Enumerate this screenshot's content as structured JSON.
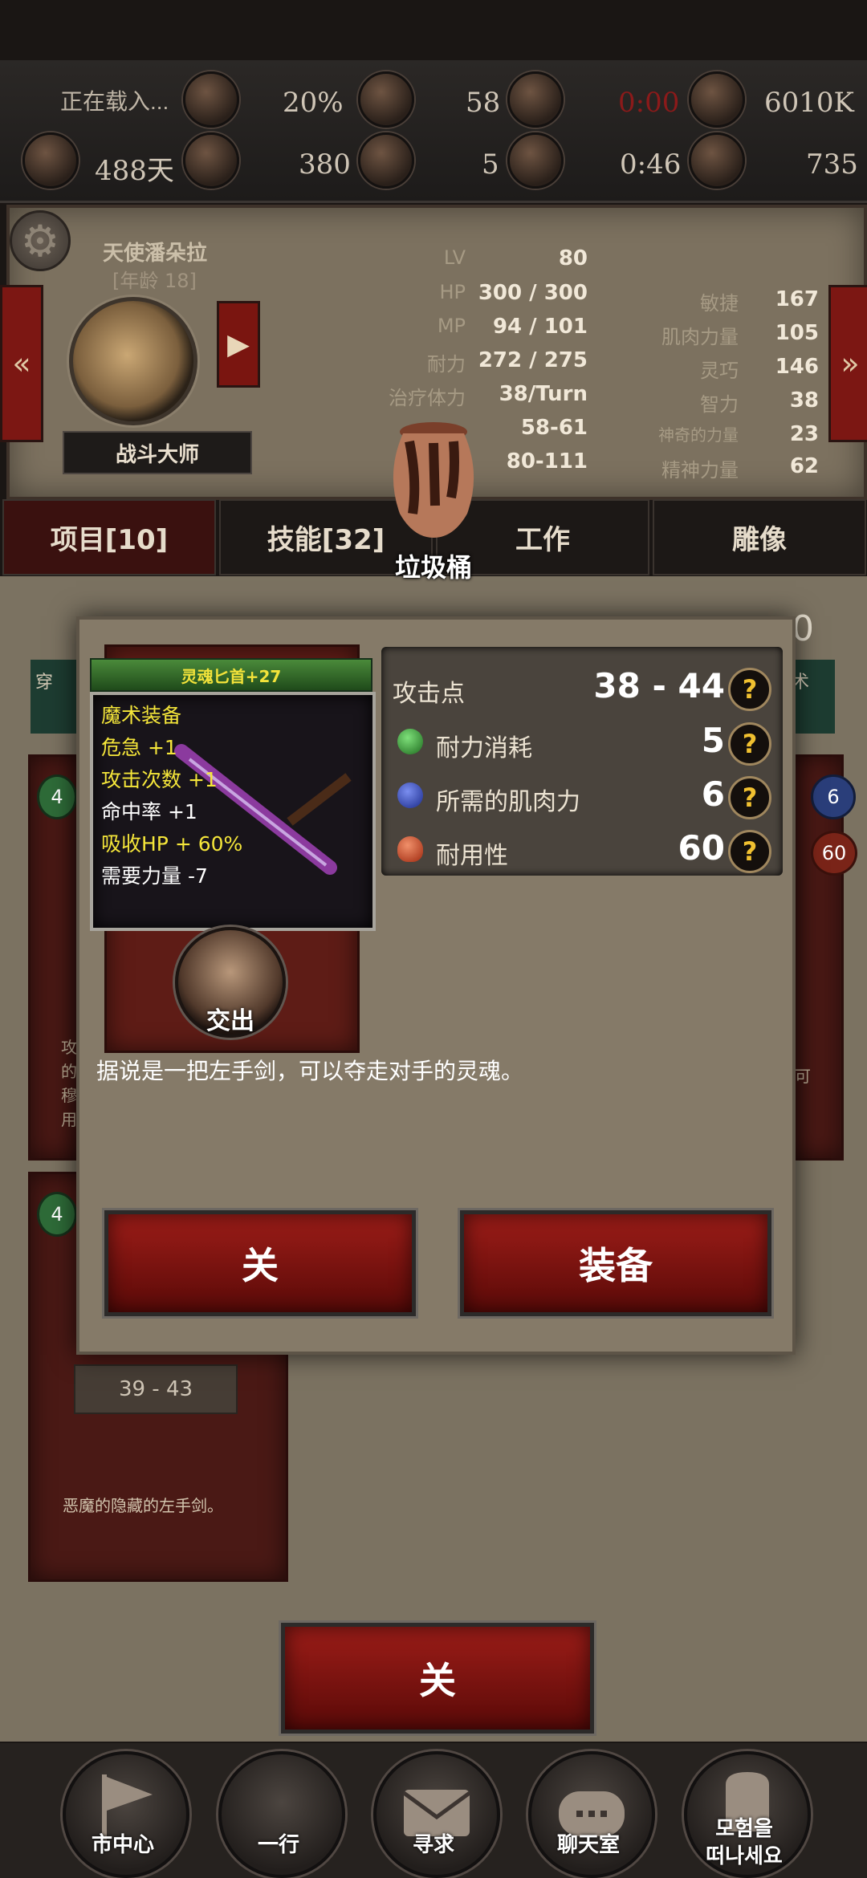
{
  "status": {
    "loading_text": "正在载入...",
    "pct": "20%",
    "r1_v2": "58",
    "r1_time_red": "0:00",
    "r1_gold": "6010K",
    "days": "488天",
    "r2_v1": "380",
    "r2_v2": "5",
    "r2_time": "0:46",
    "r2_v4": "735"
  },
  "character": {
    "name": "天使潘朵拉",
    "age": "[年龄 18]",
    "title": "战斗大师",
    "stats_left": [
      {
        "label": "LV",
        "value": "80"
      },
      {
        "label": "HP",
        "value": "300 / 300"
      },
      {
        "label": "MP",
        "value": "94 / 101"
      },
      {
        "label": "耐力",
        "value": "272 / 275"
      },
      {
        "label": "治疗体力",
        "value": "38/Turn"
      },
      {
        "label": "",
        "value": "58-61"
      },
      {
        "label": "",
        "value": "80-111"
      }
    ],
    "stats_right": [
      {
        "label": "敏捷",
        "value": "167"
      },
      {
        "label": "肌肉力量",
        "value": "105"
      },
      {
        "label": "灵巧",
        "value": "146"
      },
      {
        "label": "智力",
        "value": "38"
      },
      {
        "label": "神奇的力量",
        "value": "23"
      },
      {
        "label": "精神力量",
        "value": "62"
      }
    ]
  },
  "tabs": [
    "项目[10]",
    "技能[32]",
    "工作",
    "雕像"
  ],
  "trash": {
    "label": "垃圾桶"
  },
  "popup": {
    "item_name": "灵魂匕首+27",
    "effects": [
      "魔术装备",
      "危急 +1",
      "攻击次数 +1",
      "命中率 +1",
      "吸收HP + 60%",
      "需要力量 -7"
    ],
    "handover_label": "交出",
    "stats": [
      {
        "label": "攻击点",
        "value": "38 - 44"
      },
      {
        "label": "耐力消耗",
        "value": "5"
      },
      {
        "label": "所需的肌肉力",
        "value": "6"
      },
      {
        "label": "耐用性",
        "value": "60"
      }
    ],
    "help_glyph": "?",
    "description": "据说是一把左手剑，可以夺走对手的灵魂。",
    "close_label": "关",
    "equip_label": "装备"
  },
  "background": {
    "partial_left_1": "穿",
    "partial_right_1": "术",
    "partial_right_0": "0",
    "badge_left_1": "4",
    "badge_left_2": "4",
    "badge_right_1": "6",
    "badge_right_2": "60",
    "card_text_left": [
      "攻",
      "的",
      "穆",
      "用"
    ],
    "card_text_right": "可",
    "card3_value": "39 - 43",
    "card3_desc": "恶魔的隐藏的左手剑。"
  },
  "bottom_close_label": "关",
  "nav": [
    "市中心",
    "一行",
    "寻求",
    "聊天室",
    "모험을\n떠나세요"
  ],
  "colors": {
    "accent_red": "#8e1712",
    "gold_text": "#f5e63a",
    "time_red": "#8b1a1a"
  }
}
